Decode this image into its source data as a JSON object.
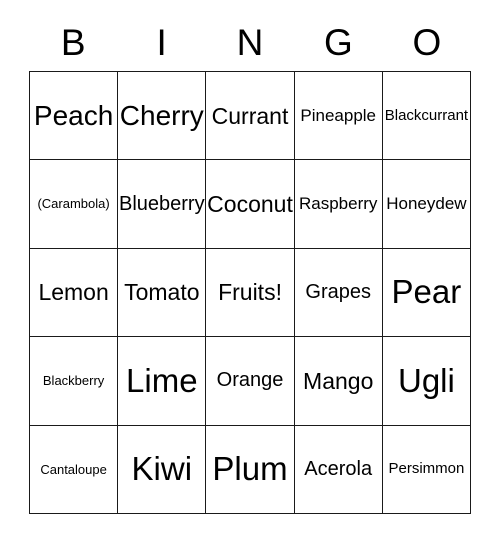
{
  "card": {
    "title_letters": [
      "B",
      "I",
      "N",
      "G",
      "O"
    ],
    "free_space_label": "Fruits!",
    "colors": {
      "background": "#ffffff",
      "grid_line": "#1a1a1a",
      "text": "#000000"
    },
    "grid": {
      "columns": 5,
      "rows": 5,
      "cells": [
        [
          {
            "label": "Peach",
            "size": "xxl"
          },
          {
            "label": "Cherry",
            "size": "xxl"
          },
          {
            "label": "Currant",
            "size": "xl"
          },
          {
            "label": "Pineapple",
            "size": "m"
          },
          {
            "label": "Blackcurrant",
            "size": "s"
          }
        ],
        [
          {
            "label": "(Carambola)",
            "size": "xs"
          },
          {
            "label": "Blueberry",
            "size": "l"
          },
          {
            "label": "Coconut",
            "size": "xl"
          },
          {
            "label": "Raspberry",
            "size": "m"
          },
          {
            "label": "Honeydew",
            "size": "m"
          }
        ],
        [
          {
            "label": "Lemon",
            "size": "xl"
          },
          {
            "label": "Tomato",
            "size": "xl"
          },
          {
            "label": "Fruits!",
            "size": "xl"
          },
          {
            "label": "Grapes",
            "size": "l"
          },
          {
            "label": "Pear",
            "size": "huge"
          }
        ],
        [
          {
            "label": "Blackberry",
            "size": "xs"
          },
          {
            "label": "Lime",
            "size": "huge"
          },
          {
            "label": "Orange",
            "size": "l"
          },
          {
            "label": "Mango",
            "size": "xl"
          },
          {
            "label": "Ugli",
            "size": "huge"
          }
        ],
        [
          {
            "label": "Cantaloupe",
            "size": "xs"
          },
          {
            "label": "Kiwi",
            "size": "huge"
          },
          {
            "label": "Plum",
            "size": "huge"
          },
          {
            "label": "Acerola",
            "size": "l"
          },
          {
            "label": "Persimmon",
            "size": "s"
          }
        ]
      ]
    }
  }
}
